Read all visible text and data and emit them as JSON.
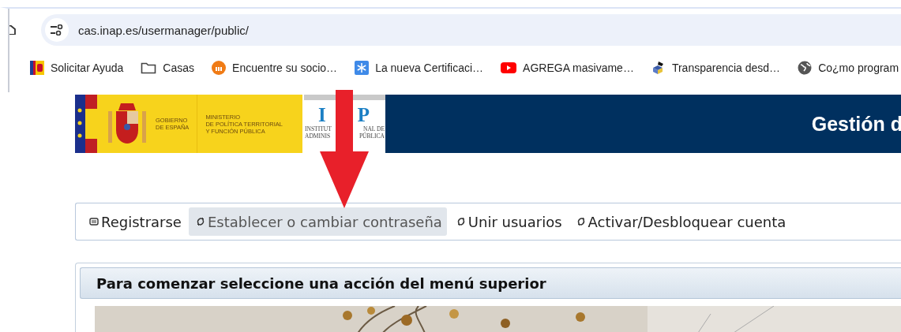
{
  "browser": {
    "url": "cas.inap.es/usermanager/public/",
    "bookmarks": [
      {
        "label": "Solicitar Ayuda",
        "kind": "flag"
      },
      {
        "label": "Casas",
        "kind": "folder"
      },
      {
        "label": "Encuentre su socio…",
        "kind": "orange"
      },
      {
        "label": "La nueva Certificaci…",
        "kind": "snow"
      },
      {
        "label": "AGREGA masivame…",
        "kind": "video"
      },
      {
        "label": "Transparencia desd…",
        "kind": "cube"
      },
      {
        "label": "Co¿mo program",
        "kind": "globe"
      }
    ]
  },
  "header": {
    "government": [
      "GOBIERNO",
      "DE ESPAÑA"
    ],
    "ministry": [
      "MINISTERIO",
      "DE POLÍTICA TERRITORIAL",
      "Y FUNCIÓN PÚBLICA"
    ],
    "inap": {
      "left": "I",
      "right": "P",
      "line_1": [
        "INSTITUT",
        "NAL DE"
      ],
      "line_2": [
        "ADMINIS",
        "PÚBLICA"
      ]
    },
    "title": "Gestión d"
  },
  "menu": [
    {
      "label": "Registrarse",
      "kind": "card",
      "selected": false
    },
    {
      "label": "Establecer o cambiar contraseña",
      "kind": "cycle",
      "selected": true
    },
    {
      "label": "Unir usuarios",
      "kind": "cycle",
      "selected": false
    },
    {
      "label": "Activar/Desbloquear cuenta",
      "kind": "cycle",
      "selected": false
    }
  ],
  "panel": {
    "title": "Para comenzar seleccione una acción del menú superior"
  }
}
